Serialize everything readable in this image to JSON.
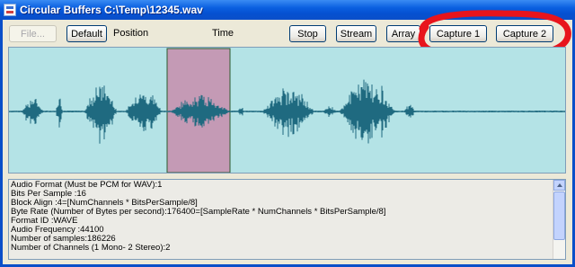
{
  "window": {
    "title": "Circular Buffers C:\\Temp\\12345.wav"
  },
  "toolbar": {
    "file_label": "File...",
    "default_label": "Default",
    "position_label": "Position",
    "time_label": "Time",
    "stop_label": "Stop",
    "stream_label": "Stream",
    "array_label": "Array",
    "capture1_label": "Capture 1",
    "capture2_label": "Capture 2"
  },
  "colors": {
    "wave_background": "#b4e3e6",
    "waveform": "#1f6a80",
    "selection_fill": "#c49ab5",
    "annotation_circle": "#e8141c"
  },
  "info": {
    "lines": [
      "Audio Format (Must be PCM for WAV):1",
      "Bits Per Sample :16",
      "Block Align :4=[NumChannels * BitsPerSample/8]",
      "Byte Rate (Number of Bytes per second):176400=[SampleRate * NumChannels * BitsPerSample/8]",
      "Format ID :WAVE",
      "Audio Frequency :44100",
      "Number of samples:186226",
      "Number of Channels (1 Mono- 2 Stereo):2"
    ]
  }
}
